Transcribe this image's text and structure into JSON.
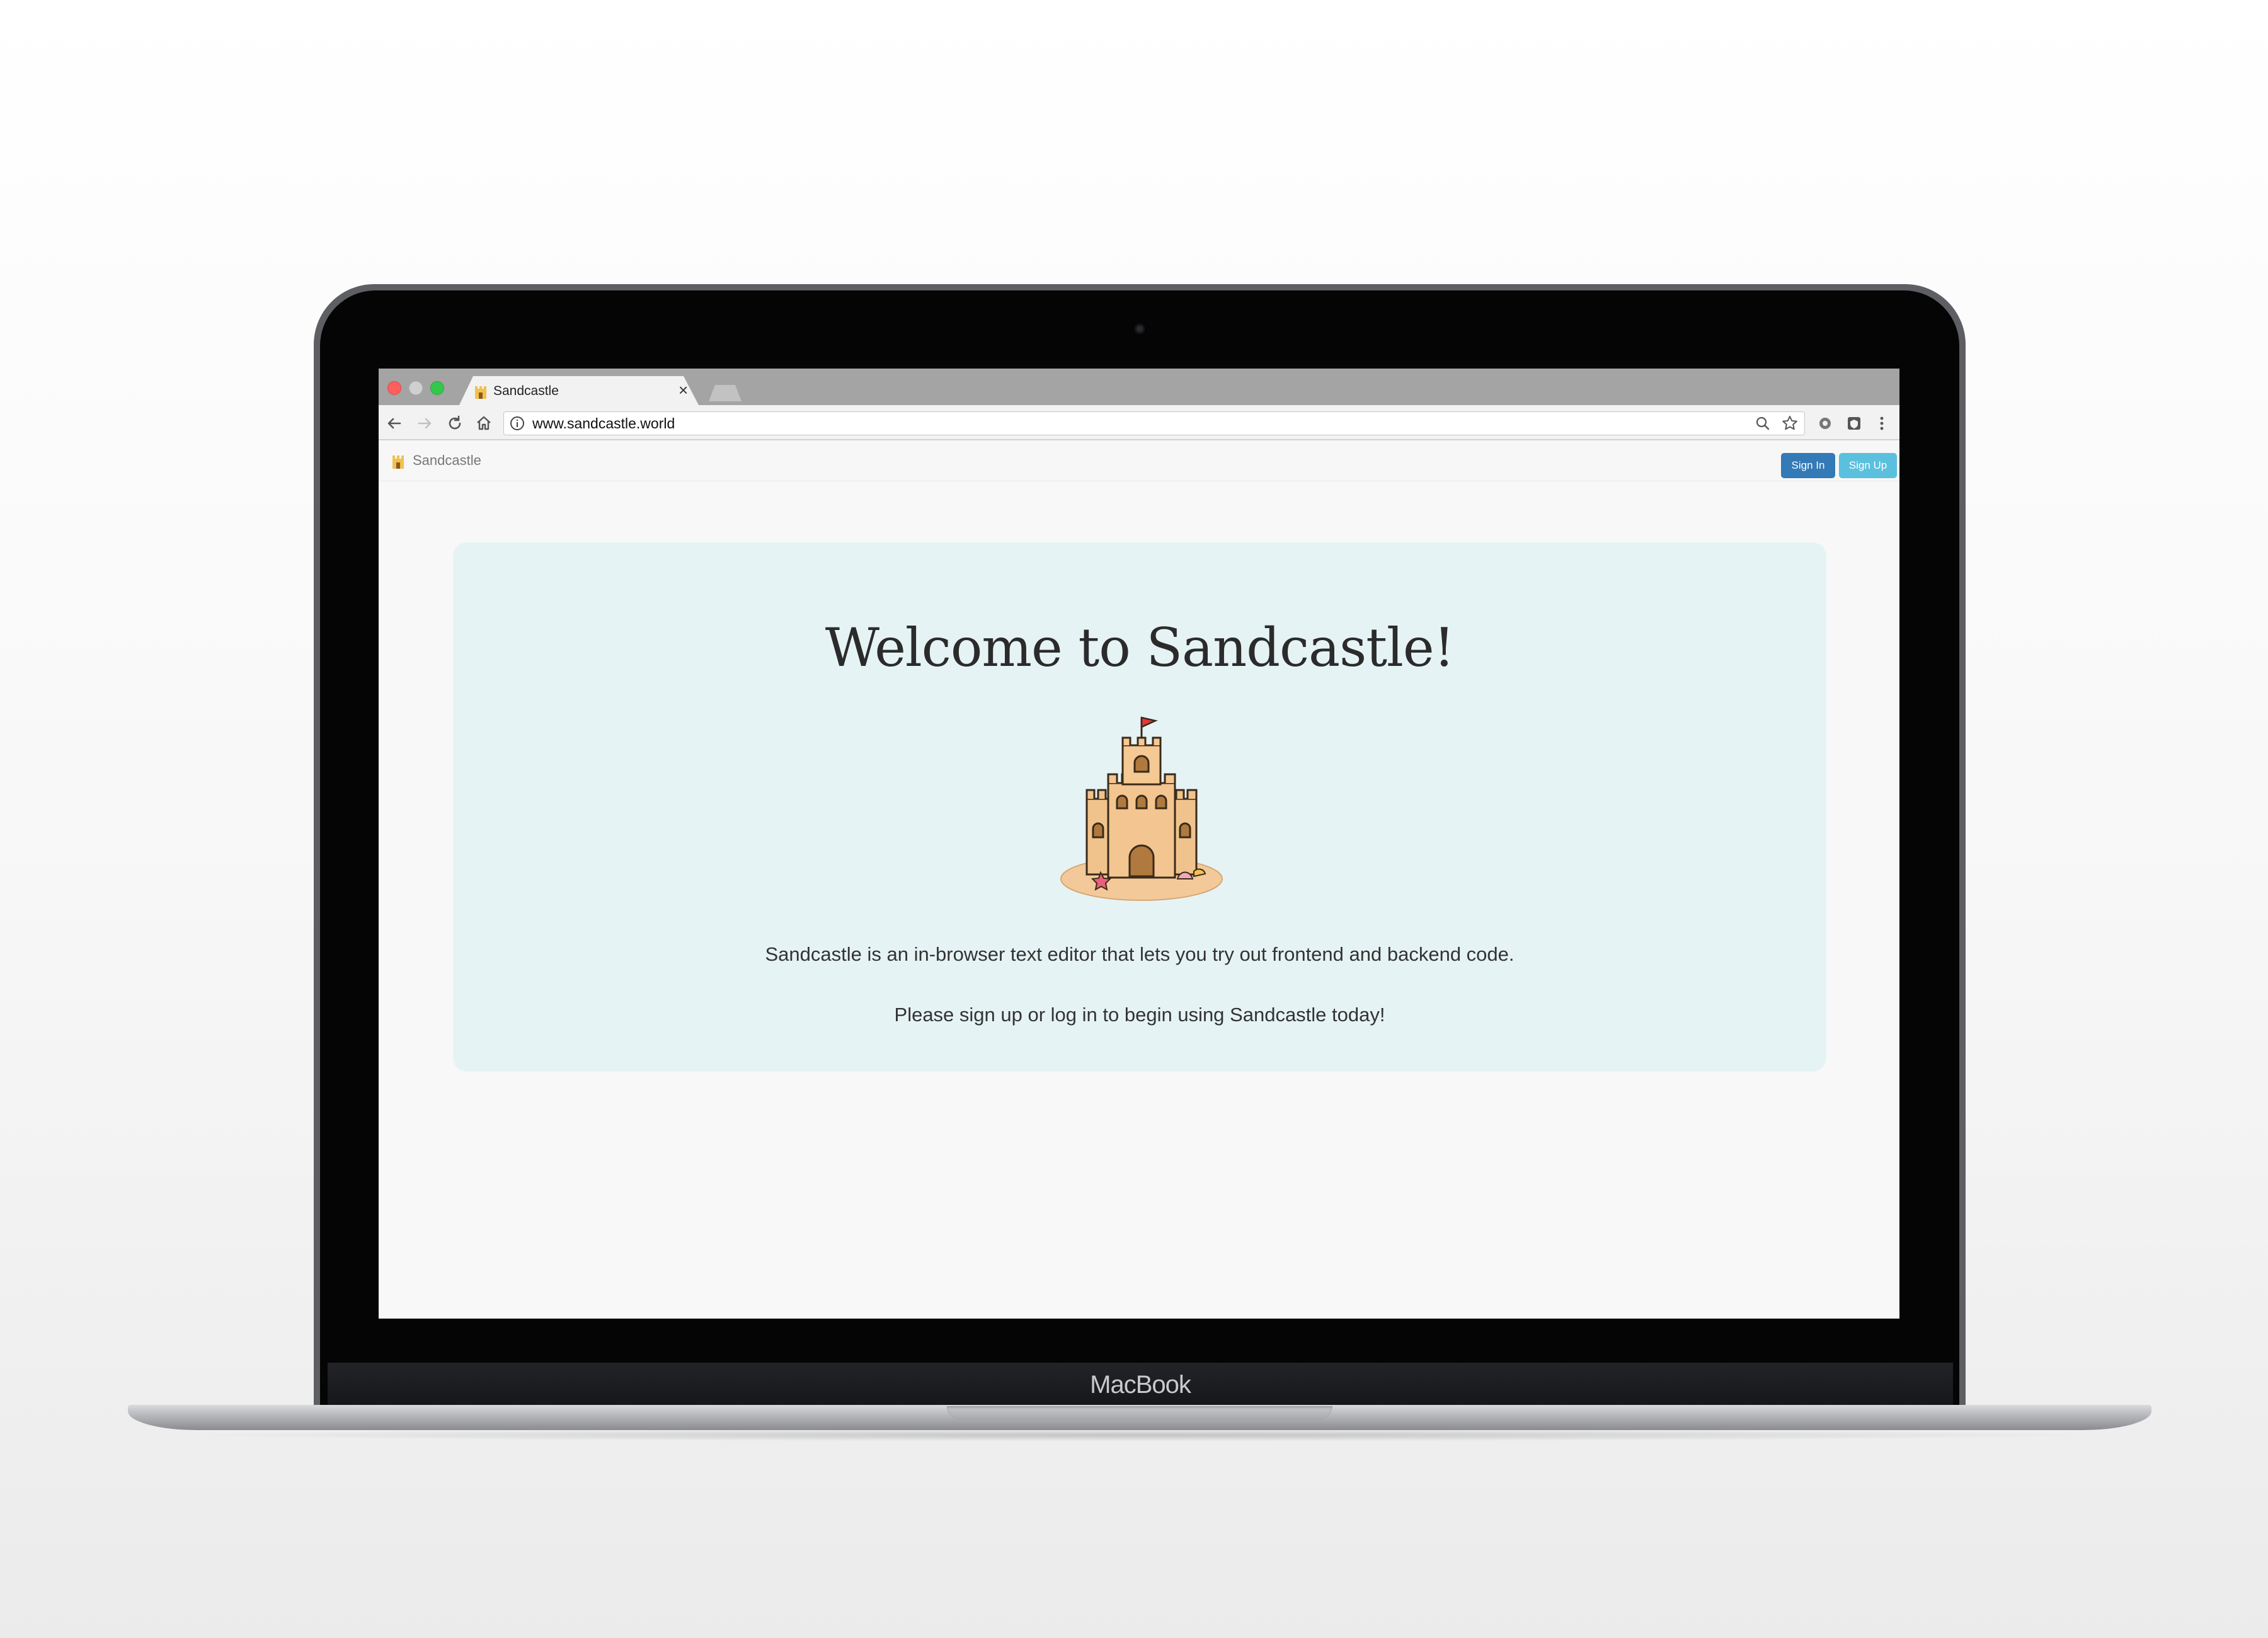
{
  "device": {
    "brand_label": "MacBook"
  },
  "browser": {
    "tab": {
      "title": "Sandcastle",
      "close_glyph": "×"
    },
    "toolbar": {
      "back_icon": "arrow-left-icon",
      "forward_icon": "arrow-right-icon",
      "reload_icon": "reload-icon",
      "home_icon": "home-icon"
    },
    "omnibox": {
      "url": "www.sandcastle.world",
      "info_icon": "info-icon",
      "zoom_icon": "magnifier-icon",
      "bookmark_icon": "star-icon"
    },
    "extensions": [
      "extension-gear-icon",
      "extension-shield-icon",
      "menu-dots-icon"
    ]
  },
  "site": {
    "navbar": {
      "brand": "Sandcastle",
      "sign_in": "Sign In",
      "sign_up": "Sign Up"
    },
    "hero": {
      "title": "Welcome to Sandcastle!",
      "description": "Sandcastle is an in-browser text editor that lets you try out frontend and backend code.",
      "cta": "Please sign up or log in to begin using Sandcastle today!",
      "illustration": "sandcastle-illustration"
    },
    "colors": {
      "jumbotron_bg": "#e6f3f5",
      "sign_in_bg": "#337ab7",
      "sign_up_bg": "#5bc0de"
    }
  }
}
